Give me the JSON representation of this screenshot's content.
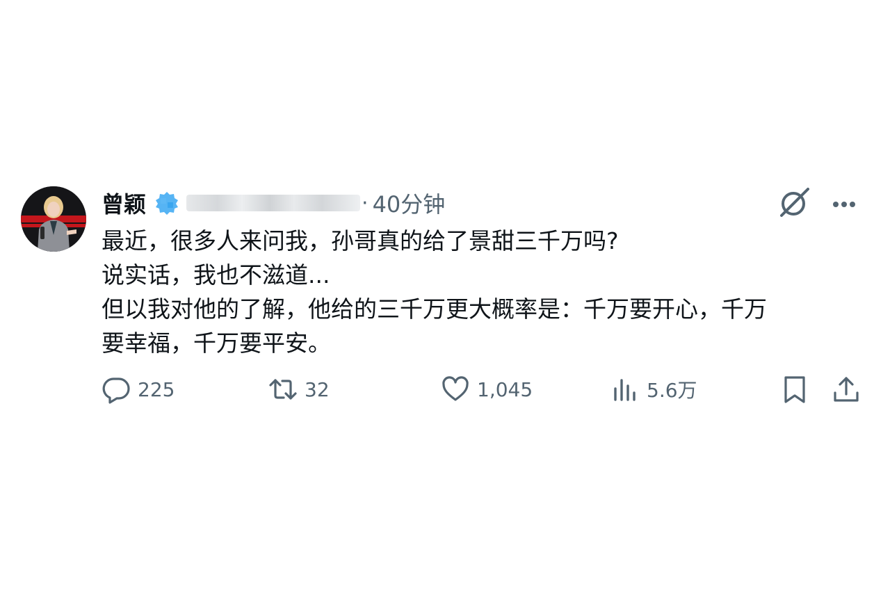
{
  "tweet": {
    "author_name": "曾颖",
    "separator": "·",
    "time": "40分钟",
    "lines": [
      "最近，很多人来问我，孙哥真的给了景甜三千万吗?",
      "说实话，我也不滋道...",
      "但以我对他的了解，他给的三千万更大概率是：千万要开心，千万",
      "要幸福，千万要平安。"
    ]
  },
  "actions": {
    "replies": "225",
    "retweets": "32",
    "likes": "1,045",
    "views": "5.6万"
  },
  "icons": {
    "verified": "verified-badge-icon",
    "grok": "grok-icon",
    "more": "more-icon",
    "reply": "reply-icon",
    "retweet": "retweet-icon",
    "like": "heart-icon",
    "views": "views-icon",
    "bookmark": "bookmark-icon",
    "share": "share-icon"
  },
  "colors": {
    "text": "#0f1419",
    "muted": "#536471",
    "verified": "#1d9bf0"
  }
}
